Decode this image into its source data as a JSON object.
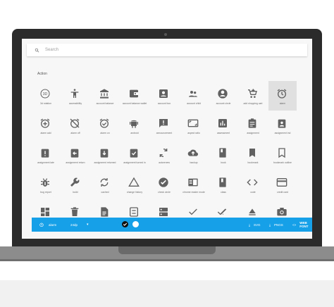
{
  "search": {
    "placeholder": "Search"
  },
  "section": {
    "title": "Action"
  },
  "icons": [
    {
      "name": "3d-rotation",
      "label": "3d rotation"
    },
    {
      "name": "accessibility",
      "label": "accessibility"
    },
    {
      "name": "account-balance",
      "label": "account balance"
    },
    {
      "name": "account-balance-wallet",
      "label": "account balance wallet"
    },
    {
      "name": "account-box",
      "label": "account box"
    },
    {
      "name": "account-child",
      "label": "account child"
    },
    {
      "name": "account-circle",
      "label": "account circle"
    },
    {
      "name": "add-shopping-cart",
      "label": "add shopping cart"
    },
    {
      "name": "alarm",
      "label": "alarm",
      "selected": true
    },
    {
      "name": "alarm-add",
      "label": "alarm add"
    },
    {
      "name": "alarm-off",
      "label": "alarm off"
    },
    {
      "name": "alarm-on",
      "label": "alarm on"
    },
    {
      "name": "android",
      "label": "android"
    },
    {
      "name": "announcement",
      "label": "announcement"
    },
    {
      "name": "aspect-ratio",
      "label": "aspect ratio"
    },
    {
      "name": "assessment",
      "label": "assessment"
    },
    {
      "name": "assignment",
      "label": "assignment"
    },
    {
      "name": "assignment-ind",
      "label": "assignment ind"
    },
    {
      "name": "assignment-late",
      "label": "assignment late"
    },
    {
      "name": "assignment-return",
      "label": "assignment return"
    },
    {
      "name": "assignment-returned",
      "label": "assignment returned"
    },
    {
      "name": "assignment-turned-in",
      "label": "assignment turned in"
    },
    {
      "name": "autorenew",
      "label": "autorenew"
    },
    {
      "name": "backup",
      "label": "backup"
    },
    {
      "name": "book",
      "label": "book"
    },
    {
      "name": "bookmark",
      "label": "bookmark"
    },
    {
      "name": "bookmark-outline",
      "label": "bookmark outline"
    },
    {
      "name": "bug-report",
      "label": "bug report"
    },
    {
      "name": "build",
      "label": "build"
    },
    {
      "name": "cached",
      "label": "cached"
    },
    {
      "name": "change-history",
      "label": "change history"
    },
    {
      "name": "check-circle",
      "label": "check circle"
    },
    {
      "name": "chrome-reader-mode",
      "label": "chrome reader mode"
    },
    {
      "name": "class",
      "label": "class"
    },
    {
      "name": "code",
      "label": "code"
    },
    {
      "name": "credit-card",
      "label": "credit card"
    },
    {
      "name": "dashboard",
      "label": ""
    },
    {
      "name": "delete",
      "label": ""
    },
    {
      "name": "description",
      "label": ""
    },
    {
      "name": "dns",
      "label": ""
    },
    {
      "name": "dns-2",
      "label": ""
    },
    {
      "name": "done",
      "label": ""
    },
    {
      "name": "done-all",
      "label": ""
    },
    {
      "name": "eject",
      "label": ""
    },
    {
      "name": "camera",
      "label": ""
    }
  ],
  "bottombar": {
    "selected_icon": "alarm",
    "size": "24dp",
    "svg_label": "SVG",
    "png_label": "PNGS",
    "webfont_label": "WEB FONT"
  },
  "colors": {
    "accent": "#16a0e8",
    "icon": "#616161",
    "selected_bg": "#e0e0e0"
  }
}
